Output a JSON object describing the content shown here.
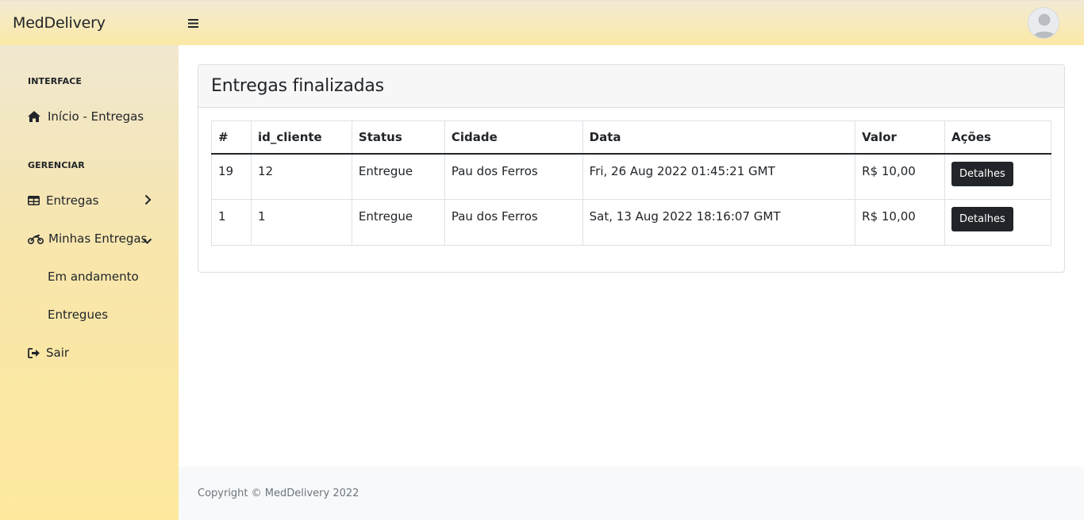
{
  "header": {
    "brand": "MedDelivery",
    "toggle_icon": "hamburger-icon",
    "avatar_icon": "user-avatar-icon"
  },
  "sidebar": {
    "heading_interface": "INTERFACE",
    "home_label": "Início - Entregas",
    "heading_manage": "GERENCIAR",
    "entregas_label": "Entregas",
    "minhas_label": "Minhas Entregas",
    "sub_andamento": "Em andamento",
    "sub_entregues": "Entregues",
    "sair_label": "Sair"
  },
  "main": {
    "title": "Entregas finalizadas",
    "columns": [
      "#",
      "id_cliente",
      "Status",
      "Cidade",
      "Data",
      "Valor",
      "Ações"
    ],
    "rows": [
      {
        "id": "19",
        "id_cliente": "12",
        "status": "Entregue",
        "cidade": "Pau dos Ferros",
        "data": "Fri, 26 Aug 2022 01:45:21 GMT",
        "valor": "R$ 10,00",
        "action": "Detalhes"
      },
      {
        "id": "1",
        "id_cliente": "1",
        "status": "Entregue",
        "cidade": "Pau dos Ferros",
        "data": "Sat, 13 Aug 2022 18:16:07 GMT",
        "valor": "R$ 10,00",
        "action": "Detalhes"
      }
    ]
  },
  "footer": {
    "copyright": "Copyright © MedDelivery 2022"
  },
  "colors": {
    "accent_yellow": "#fce9a6",
    "button_dark": "#212529"
  }
}
